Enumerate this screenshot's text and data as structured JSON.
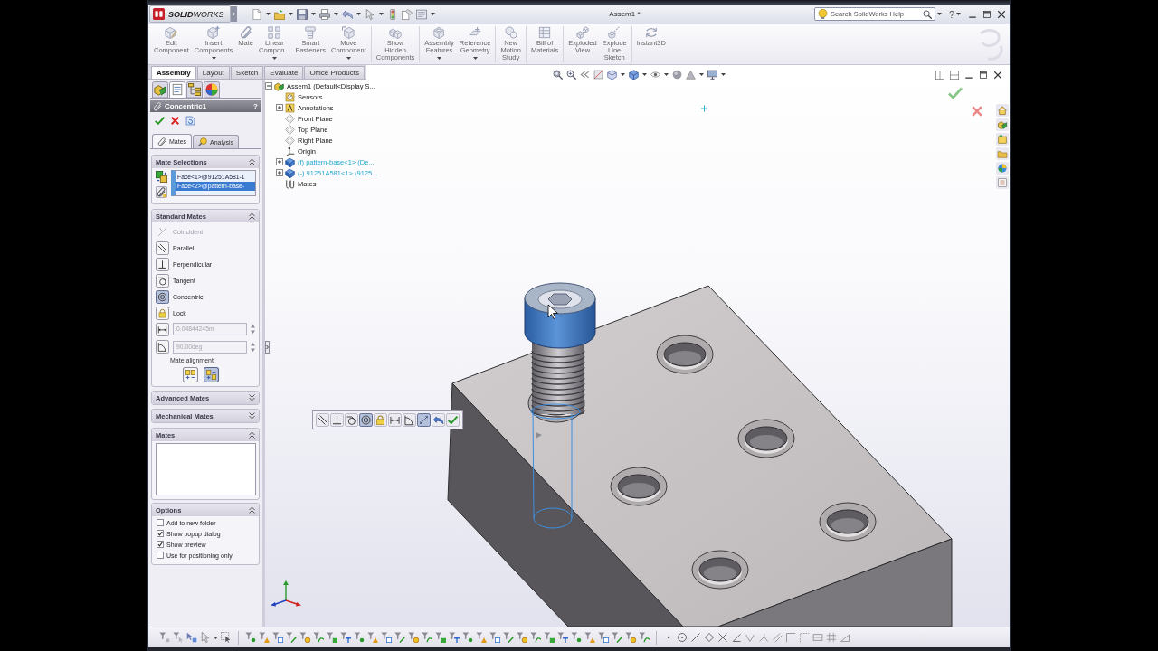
{
  "window": {
    "logo": "**SOLID**WORKS",
    "title": "Assem1 *",
    "search": {
      "placeholder": "Search SolidWorks Help"
    },
    "help": "?"
  },
  "ribbon": {
    "buttons": [
      {
        "label": "Edit\nComponent",
        "dropdown": false,
        "separator_after": false
      },
      {
        "label": "Insert\nComponents",
        "dropdown": true,
        "separator_after": false
      },
      {
        "label": "Mate",
        "dropdown": false,
        "separator_after": false
      },
      {
        "label": "Linear\nCompon...",
        "dropdown": true,
        "separator_after": false
      },
      {
        "label": "Smart\nFasteners",
        "dropdown": false,
        "separator_after": false
      },
      {
        "label": "Move\nComponent",
        "dropdown": true,
        "separator_after": true
      },
      {
        "label": "Show\nHidden\nComponents",
        "dropdown": false,
        "separator_after": true
      },
      {
        "label": "Assembly\nFeatures",
        "dropdown": true,
        "separator_after": false
      },
      {
        "label": "Reference\nGeometry",
        "dropdown": true,
        "separator_after": true
      },
      {
        "label": "New\nMotion\nStudy",
        "dropdown": false,
        "separator_after": true
      },
      {
        "label": "Bill of\nMaterials",
        "dropdown": false,
        "separator_after": true
      },
      {
        "label": "Exploded\nView",
        "dropdown": false,
        "separator_after": false
      },
      {
        "label": "Explode\nLine\nSketch",
        "dropdown": false,
        "separator_after": true
      },
      {
        "label": "Instant3D",
        "dropdown": false,
        "separator_after": false
      }
    ]
  },
  "tabs": [
    {
      "label": "Assembly",
      "selected": true
    },
    {
      "label": "Layout",
      "selected": false
    },
    {
      "label": "Sketch",
      "selected": false
    },
    {
      "label": "Evaluate",
      "selected": false
    },
    {
      "label": "Office Products",
      "selected": false
    }
  ],
  "property_manager": {
    "manager_tabs": [
      {
        "selected": false
      },
      {
        "selected": true
      },
      {
        "selected": false
      },
      {
        "selected": false
      }
    ],
    "title": "Concentric1",
    "help": "?",
    "subtabs": [
      {
        "label": "Mates",
        "selected": true
      },
      {
        "label": "Analysis",
        "selected": false
      }
    ],
    "sections": [
      {
        "kind": "selections",
        "title": "Mate Selections",
        "expanded": true,
        "items": [
          {
            "text": "Face<1>@91251A581-1",
            "selected": false
          },
          {
            "text": "Face<2>@pattern-base-",
            "selected": true
          }
        ]
      },
      {
        "kind": "standard",
        "title": "Standard Mates",
        "expanded": true,
        "mates": [
          {
            "label": "Coincident",
            "selected": false,
            "disabled": true
          },
          {
            "label": "Parallel",
            "selected": false,
            "disabled": false
          },
          {
            "label": "Perpendicular",
            "selected": false,
            "disabled": false
          },
          {
            "label": "Tangent",
            "selected": false,
            "disabled": false
          },
          {
            "label": "Concentric",
            "selected": true,
            "disabled": false
          },
          {
            "label": "Lock",
            "selected": false,
            "disabled": false
          }
        ],
        "distance": {
          "value": "0.04844245m",
          "disabled": true
        },
        "angle": {
          "value": "90.00deg",
          "disabled": true
        },
        "alignment_label": "Mate alignment:",
        "alignment": [
          {
            "selected": false
          },
          {
            "selected": true
          }
        ]
      },
      {
        "kind": "group",
        "title": "Advanced Mates",
        "expanded": false
      },
      {
        "kind": "group",
        "title": "Mechanical Mates",
        "expanded": false
      },
      {
        "kind": "list",
        "title": "Mates",
        "expanded": true
      },
      {
        "kind": "options",
        "title": "Options",
        "expanded": true,
        "options": [
          {
            "label": "Add to new folder",
            "checked": false
          },
          {
            "label": "Show popup dialog",
            "checked": true
          },
          {
            "label": "Show preview",
            "checked": true
          },
          {
            "label": "Use for positioning only",
            "checked": false
          }
        ]
      }
    ]
  },
  "feature_tree": {
    "root": {
      "label": "Assem1 (Default<Display S...",
      "kind": "assembly",
      "expanded": true,
      "highlighted": false,
      "children": [
        {
          "label": "Sensors",
          "kind": "sensors",
          "highlighted": false
        },
        {
          "label": "Annotations",
          "kind": "annotations",
          "expanded": false,
          "highlighted": false
        },
        {
          "label": "Front Plane",
          "kind": "plane",
          "highlighted": false
        },
        {
          "label": "Top Plane",
          "kind": "plane",
          "highlighted": false
        },
        {
          "label": "Right Plane",
          "kind": "plane",
          "highlighted": false
        },
        {
          "label": "Origin",
          "kind": "origin",
          "highlighted": false
        },
        {
          "label": "(f) pattern-base<1> (De...",
          "kind": "component",
          "expanded": false,
          "highlighted": true
        },
        {
          "label": "(-) 91251A581<1> (9125...",
          "kind": "component",
          "expanded": false,
          "highlighted": true
        },
        {
          "label": "Mates",
          "kind": "mates",
          "highlighted": false
        }
      ]
    }
  },
  "mate_popup": {
    "buttons": [
      {
        "selected": false
      },
      {
        "selected": false
      },
      {
        "selected": false
      },
      {
        "selected": true
      },
      {
        "selected": false
      },
      {
        "selected": false
      },
      {
        "selected": false
      },
      {
        "selected": true
      },
      {
        "selected": false
      },
      {
        "selected": false
      }
    ]
  }
}
